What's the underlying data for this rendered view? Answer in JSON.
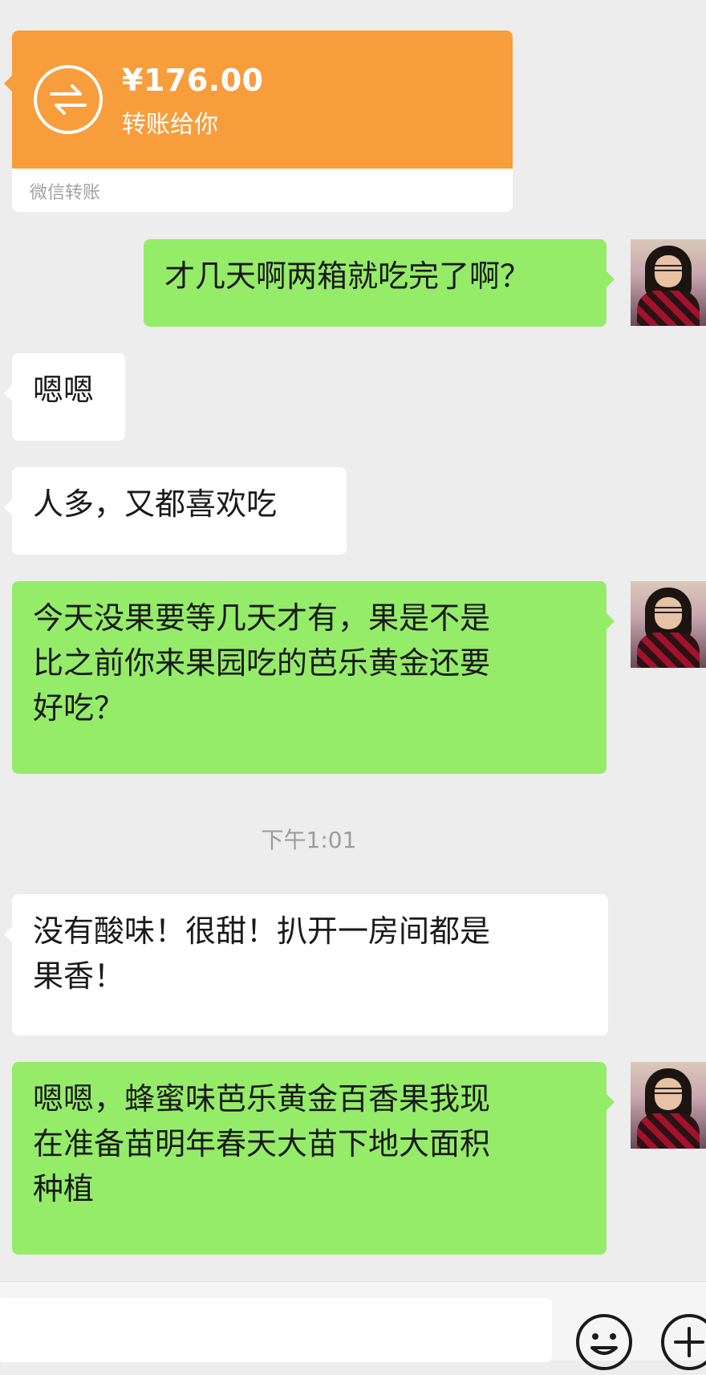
{
  "transfer": {
    "amount": "¥176.00",
    "description": "转账给你",
    "footer": "微信转账"
  },
  "messages": [
    {
      "side": "out",
      "text": "才几天啊两箱就吃完了啊？"
    },
    {
      "side": "in",
      "text": "嗯嗯"
    },
    {
      "side": "in",
      "text": "人多，又都喜欢吃"
    },
    {
      "side": "out",
      "text": "今天没果要等几天才有，果是不是\n比之前你来果园吃的芭乐黄金还要\n好吃？"
    },
    {
      "side": "in",
      "text": "没有酸味！很甜！扒开一房间都是\n果香！"
    },
    {
      "side": "out",
      "text": "嗯嗯，蜂蜜味芭乐黄金百香果我现\n在准备苗明年春天大苗下地大面积\n种植"
    }
  ],
  "timestamp": "下午1:01",
  "input_bar": {
    "input_value": "",
    "emoji_icon": "smiley-face-icon",
    "more_icon": "plus-circle-icon"
  },
  "colors": {
    "background": "#ededed",
    "outgoing_bubble": "#95ec69",
    "incoming_bubble": "#ffffff",
    "transfer_card": "#f89d3c",
    "timestamp_text": "#9c9c9c"
  }
}
